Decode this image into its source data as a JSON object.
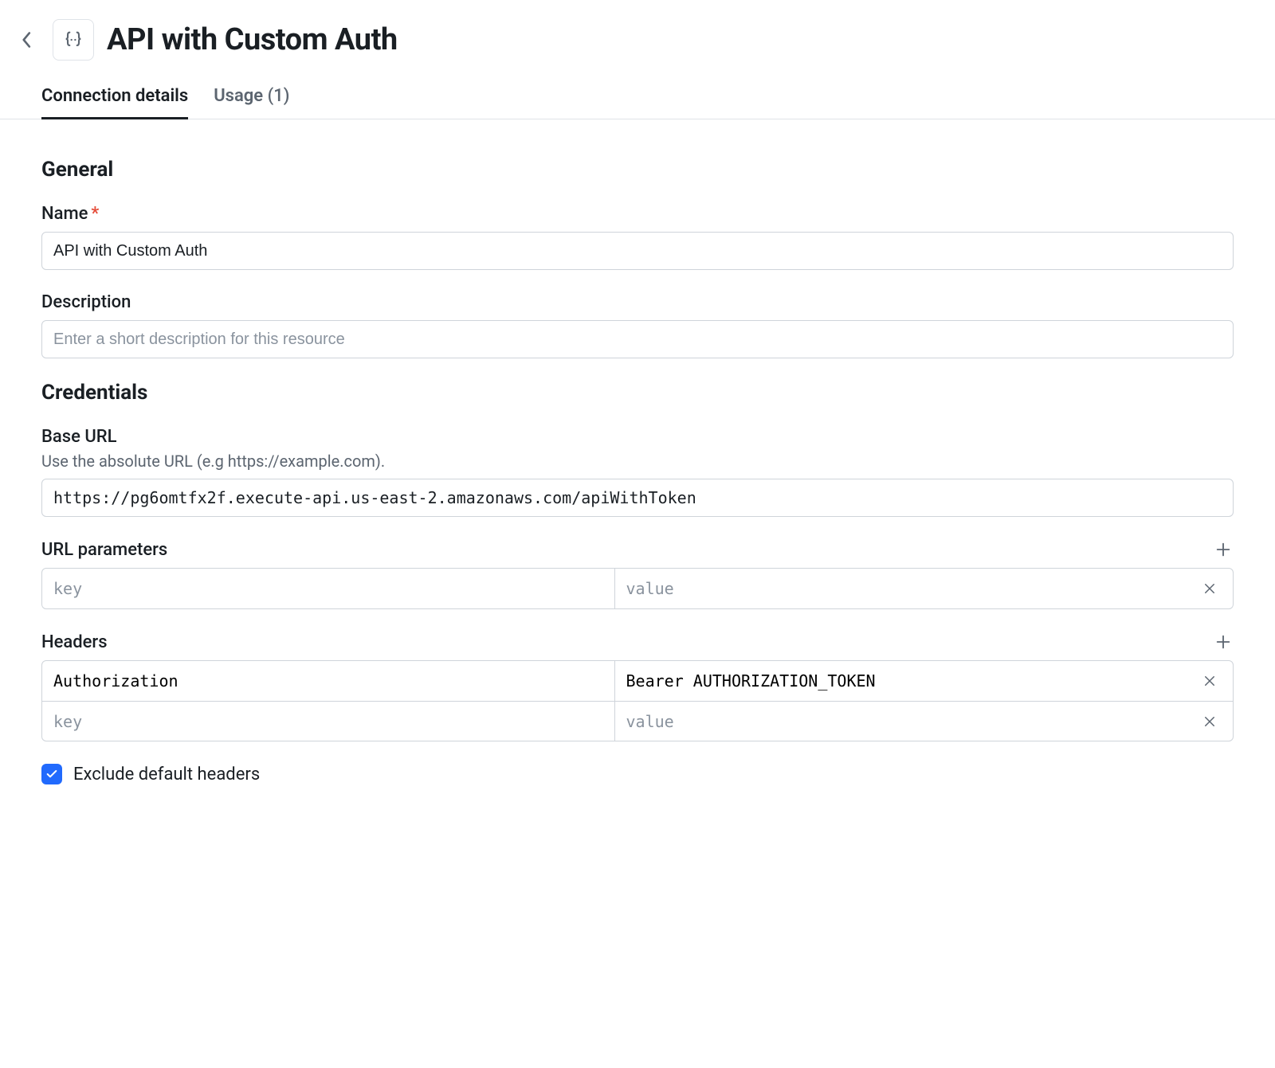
{
  "header": {
    "title": "API with Custom Auth"
  },
  "tabs": {
    "connection": {
      "label": "Connection details",
      "active": true
    },
    "usage": {
      "label": "Usage",
      "count": "(1)",
      "active": false
    }
  },
  "general": {
    "heading": "General",
    "name_label": "Name",
    "name_value": "API with Custom Auth",
    "desc_label": "Description",
    "desc_value": "",
    "desc_placeholder": "Enter a short description for this resource"
  },
  "credentials": {
    "heading": "Credentials",
    "baseurl_label": "Base URL",
    "baseurl_hint": "Use the absolute URL (e.g https://example.com).",
    "baseurl_value": "https://pg6omtfx2f.execute-api.us-east-2.amazonaws.com/apiWithToken",
    "url_params_label": "URL parameters",
    "url_params": [
      {
        "key": "",
        "value": ""
      }
    ],
    "headers_label": "Headers",
    "headers": [
      {
        "key": "Authorization",
        "value": "Bearer AUTHORIZATION_TOKEN"
      },
      {
        "key": "",
        "value": ""
      }
    ],
    "kv_key_placeholder": "key",
    "kv_value_placeholder": "value",
    "exclude_default_checked": true,
    "exclude_default_label": "Exclude default headers"
  }
}
